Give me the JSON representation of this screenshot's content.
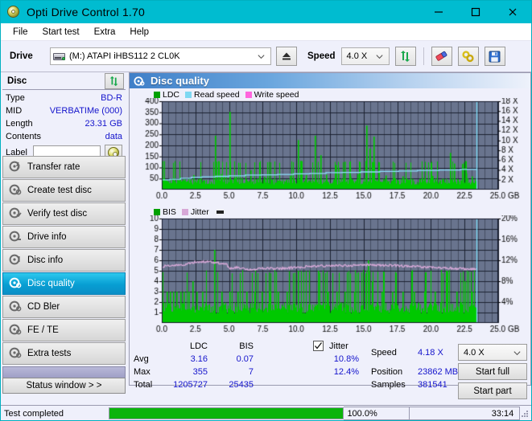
{
  "window": {
    "title": "Opti Drive Control 1.70",
    "icon": "disc-icon",
    "minimize": "—",
    "maximize": "□",
    "close": "✕"
  },
  "menu": {
    "items": [
      "File",
      "Start test",
      "Extra",
      "Help"
    ]
  },
  "toolbar": {
    "drive_label": "Drive",
    "drive_value": "(M:)  ATAPI iHBS112  2 CL0K",
    "eject_icon": "eject-icon",
    "speed_label": "Speed",
    "speed_value": "4.0 X",
    "refresh_icon": "refresh-icon",
    "eraser_icon": "eraser-icon",
    "link_icon": "link-icon",
    "save_icon": "save-icon"
  },
  "disc_panel": {
    "title": "Disc",
    "refresh_icon": "refresh-icon",
    "rows": [
      {
        "key": "Type",
        "value": "BD-R"
      },
      {
        "key": "MID",
        "value": "VERBATIMe (000)"
      },
      {
        "key": "Length",
        "value": "23.31 GB"
      },
      {
        "key": "Contents",
        "value": "data"
      }
    ],
    "label_key": "Label",
    "label_value": "",
    "label_placeholder": "",
    "label_button_icon": "disc-icon"
  },
  "sidebar": {
    "items": [
      {
        "label": "Transfer rate",
        "icon": "disc-bolt-icon",
        "selected": false
      },
      {
        "label": "Create test disc",
        "icon": "disc-create-icon",
        "selected": false
      },
      {
        "label": "Verify test disc",
        "icon": "disc-verify-icon",
        "selected": false
      },
      {
        "label": "Drive info",
        "icon": "drive-info-icon",
        "selected": false
      },
      {
        "label": "Disc info",
        "icon": "disc-info-icon",
        "selected": false
      },
      {
        "label": "Disc quality",
        "icon": "disc-quality-icon",
        "selected": true
      },
      {
        "label": "CD Bler",
        "icon": "disc-bler-icon",
        "selected": false
      },
      {
        "label": "FE / TE",
        "icon": "disc-fete-icon",
        "selected": false
      },
      {
        "label": "Extra tests",
        "icon": "disc-extra-icon",
        "selected": false
      }
    ],
    "status_button": "Status window > >"
  },
  "panel": {
    "title": "Disc quality",
    "icon": "disc-quality-icon"
  },
  "chart_data": [
    {
      "type": "line",
      "name": "ldc-chart",
      "title": "",
      "legend": [
        {
          "label": "LDC",
          "color": "#00a000"
        },
        {
          "label": "Read speed",
          "color": "#7fd8f2"
        },
        {
          "label": "Write speed",
          "color": "#ff66dd"
        }
      ],
      "legend_position": "top-left",
      "xlabel": "GB",
      "x_unit": "GB",
      "xlim": [
        0,
        25
      ],
      "xticks": [
        "0.0",
        "2.5",
        "5.0",
        "7.5",
        "10.0",
        "12.5",
        "15.0",
        "17.5",
        "20.0",
        "22.5",
        "25.0"
      ],
      "ylabel": "",
      "ylim": [
        0,
        400
      ],
      "yticks": [
        "50",
        "100",
        "150",
        "200",
        "250",
        "300",
        "350",
        "400"
      ],
      "y2label": "X",
      "y2lim": [
        0,
        18
      ],
      "y2ticks": [
        "2 X",
        "4 X",
        "6 X",
        "8 X",
        "10 X",
        "12 X",
        "14 X",
        "16 X",
        "18 X"
      ],
      "grid": true,
      "data_end_gb": 23.4,
      "cursor_line_gb": 23.4,
      "series": [
        {
          "name": "LDC",
          "color": "#00c800",
          "kind": "bars",
          "baseline_avg": 3.16,
          "peaks": [
            {
              "x": 1.3,
              "y": 58
            },
            {
              "x": 1.55,
              "y": 42
            },
            {
              "x": 1.8,
              "y": 35
            },
            {
              "x": 2.35,
              "y": 66
            },
            {
              "x": 2.7,
              "y": 48
            },
            {
              "x": 3.05,
              "y": 40
            },
            {
              "x": 3.95,
              "y": 244
            },
            {
              "x": 4.35,
              "y": 70
            },
            {
              "x": 4.6,
              "y": 58
            },
            {
              "x": 5.05,
              "y": 352
            },
            {
              "x": 5.5,
              "y": 60
            },
            {
              "x": 5.9,
              "y": 52
            },
            {
              "x": 6.6,
              "y": 88
            },
            {
              "x": 7.0,
              "y": 46
            },
            {
              "x": 7.6,
              "y": 58
            },
            {
              "x": 8.2,
              "y": 44
            },
            {
              "x": 8.8,
              "y": 40
            },
            {
              "x": 9.5,
              "y": 62
            },
            {
              "x": 10.1,
              "y": 224
            },
            {
              "x": 10.3,
              "y": 130
            },
            {
              "x": 10.7,
              "y": 66
            },
            {
              "x": 11.35,
              "y": 244
            },
            {
              "x": 11.8,
              "y": 156
            },
            {
              "x": 12.2,
              "y": 68
            },
            {
              "x": 12.9,
              "y": 112
            },
            {
              "x": 13.1,
              "y": 98
            },
            {
              "x": 13.55,
              "y": 126
            },
            {
              "x": 14.0,
              "y": 60
            },
            {
              "x": 14.55,
              "y": 70
            },
            {
              "x": 15.2,
              "y": 290
            },
            {
              "x": 15.45,
              "y": 186
            },
            {
              "x": 15.75,
              "y": 240
            },
            {
              "x": 16.1,
              "y": 86
            },
            {
              "x": 16.6,
              "y": 64
            },
            {
              "x": 17.2,
              "y": 52
            },
            {
              "x": 17.9,
              "y": 60
            },
            {
              "x": 18.6,
              "y": 48
            },
            {
              "x": 19.3,
              "y": 56
            },
            {
              "x": 20.1,
              "y": 62
            },
            {
              "x": 20.8,
              "y": 44
            },
            {
              "x": 21.4,
              "y": 166
            },
            {
              "x": 21.7,
              "y": 118
            },
            {
              "x": 22.3,
              "y": 116
            },
            {
              "x": 22.6,
              "y": 74
            },
            {
              "x": 23.0,
              "y": 60
            }
          ]
        },
        {
          "name": "Read speed",
          "color": "#8fe0ff",
          "kind": "step",
          "points": [
            {
              "x": 0.0,
              "y": 2.0
            },
            {
              "x": 0.6,
              "y": 2.1
            },
            {
              "x": 1.4,
              "y": 2.3
            },
            {
              "x": 2.2,
              "y": 2.5
            },
            {
              "x": 3.0,
              "y": 2.6
            },
            {
              "x": 4.0,
              "y": 2.7
            },
            {
              "x": 5.0,
              "y": 2.8
            },
            {
              "x": 6.2,
              "y": 2.95
            },
            {
              "x": 7.4,
              "y": 3.0
            },
            {
              "x": 8.6,
              "y": 3.1
            },
            {
              "x": 9.8,
              "y": 3.2
            },
            {
              "x": 11.0,
              "y": 3.3
            },
            {
              "x": 12.2,
              "y": 3.45
            },
            {
              "x": 13.4,
              "y": 3.5
            },
            {
              "x": 14.8,
              "y": 3.6
            },
            {
              "x": 16.2,
              "y": 3.7
            },
            {
              "x": 17.6,
              "y": 3.8
            },
            {
              "x": 19.0,
              "y": 3.9
            },
            {
              "x": 20.6,
              "y": 4.0
            },
            {
              "x": 22.2,
              "y": 4.1
            },
            {
              "x": 23.4,
              "y": 4.18
            }
          ]
        }
      ]
    },
    {
      "type": "line",
      "name": "bis-jitter-chart",
      "title": "",
      "legend": [
        {
          "label": "BIS",
          "color": "#00a000"
        },
        {
          "label": "Jitter",
          "color": "#d7a8d7"
        }
      ],
      "legend_position": "top-left",
      "xlabel": "GB",
      "x_unit": "GB",
      "xlim": [
        0,
        25
      ],
      "xticks": [
        "0.0",
        "2.5",
        "5.0",
        "7.5",
        "10.0",
        "12.5",
        "15.0",
        "17.5",
        "20.0",
        "22.5",
        "25.0"
      ],
      "ylim": [
        0,
        10
      ],
      "yticks": [
        "1",
        "2",
        "3",
        "4",
        "5",
        "6",
        "7",
        "8",
        "9",
        "10"
      ],
      "y2lim": [
        0,
        20
      ],
      "y2ticks": [
        "4%",
        "8%",
        "12%",
        "16%",
        "20%"
      ],
      "grid": true,
      "data_end_gb": 23.4,
      "cursor_line_gb": 23.4,
      "series": [
        {
          "name": "BIS",
          "color": "#00c800",
          "kind": "bars",
          "baseline_avg": 0.07,
          "peaks": [
            {
              "x": 0.35,
              "y": 3
            },
            {
              "x": 0.6,
              "y": 3
            },
            {
              "x": 0.85,
              "y": 3
            },
            {
              "x": 1.1,
              "y": 3
            },
            {
              "x": 1.35,
              "y": 3
            },
            {
              "x": 1.6,
              "y": 3
            },
            {
              "x": 1.95,
              "y": 3
            },
            {
              "x": 2.3,
              "y": 4
            },
            {
              "x": 2.6,
              "y": 3
            },
            {
              "x": 3.0,
              "y": 3
            },
            {
              "x": 3.9,
              "y": 7
            },
            {
              "x": 4.4,
              "y": 3
            },
            {
              "x": 5.0,
              "y": 3
            },
            {
              "x": 5.6,
              "y": 3
            },
            {
              "x": 6.3,
              "y": 3
            },
            {
              "x": 6.9,
              "y": 3
            },
            {
              "x": 7.4,
              "y": 3
            },
            {
              "x": 8.0,
              "y": 3
            },
            {
              "x": 8.6,
              "y": 3
            },
            {
              "x": 9.3,
              "y": 3
            },
            {
              "x": 10.1,
              "y": 5
            },
            {
              "x": 11.6,
              "y": 5
            },
            {
              "x": 12.3,
              "y": 3
            },
            {
              "x": 13.0,
              "y": 3
            },
            {
              "x": 13.6,
              "y": 3
            },
            {
              "x": 14.3,
              "y": 3
            },
            {
              "x": 15.3,
              "y": 6
            },
            {
              "x": 15.6,
              "y": 4
            },
            {
              "x": 16.3,
              "y": 3
            },
            {
              "x": 17.1,
              "y": 3
            },
            {
              "x": 17.9,
              "y": 3
            },
            {
              "x": 18.7,
              "y": 3
            },
            {
              "x": 19.5,
              "y": 3
            },
            {
              "x": 20.3,
              "y": 3
            },
            {
              "x": 21.2,
              "y": 5
            },
            {
              "x": 21.9,
              "y": 3
            },
            {
              "x": 22.5,
              "y": 4
            },
            {
              "x": 23.0,
              "y": 3
            }
          ]
        },
        {
          "name": "Jitter",
          "color": "#d9aad9",
          "kind": "line",
          "points": [
            {
              "x": 0.0,
              "y": 10.8
            },
            {
              "x": 0.6,
              "y": 11.0
            },
            {
              "x": 1.2,
              "y": 11.1
            },
            {
              "x": 1.8,
              "y": 11.2
            },
            {
              "x": 2.4,
              "y": 11.6
            },
            {
              "x": 3.0,
              "y": 11.8
            },
            {
              "x": 3.6,
              "y": 11.7
            },
            {
              "x": 4.2,
              "y": 11.5
            },
            {
              "x": 4.8,
              "y": 11.4
            },
            {
              "x": 5.0,
              "y": 10.5
            },
            {
              "x": 5.6,
              "y": 10.6
            },
            {
              "x": 6.2,
              "y": 10.4
            },
            {
              "x": 6.6,
              "y": 10.2
            },
            {
              "x": 7.2,
              "y": 10.4
            },
            {
              "x": 7.8,
              "y": 10.5
            },
            {
              "x": 8.6,
              "y": 10.4
            },
            {
              "x": 9.4,
              "y": 10.5
            },
            {
              "x": 10.2,
              "y": 10.7
            },
            {
              "x": 11.0,
              "y": 10.8
            },
            {
              "x": 11.8,
              "y": 10.9
            },
            {
              "x": 12.6,
              "y": 10.9
            },
            {
              "x": 13.4,
              "y": 11.0
            },
            {
              "x": 14.2,
              "y": 11.0
            },
            {
              "x": 15.0,
              "y": 11.1
            },
            {
              "x": 15.8,
              "y": 11.1
            },
            {
              "x": 16.6,
              "y": 11.0
            },
            {
              "x": 17.4,
              "y": 11.0
            },
            {
              "x": 18.2,
              "y": 10.9
            },
            {
              "x": 19.0,
              "y": 10.8
            },
            {
              "x": 19.8,
              "y": 10.7
            },
            {
              "x": 20.6,
              "y": 10.6
            },
            {
              "x": 21.4,
              "y": 10.5
            },
            {
              "x": 22.2,
              "y": 10.4
            },
            {
              "x": 23.0,
              "y": 10.3
            },
            {
              "x": 23.4,
              "y": 10.2
            }
          ]
        }
      ]
    }
  ],
  "stats": {
    "col_ldc": "LDC",
    "col_bis": "BIS",
    "jitter_label": "Jitter",
    "jitter_checked": true,
    "rows": [
      {
        "label": "Avg",
        "ldc": "3.16",
        "bis": "0.07",
        "jitter": "10.8%"
      },
      {
        "label": "Max",
        "ldc": "355",
        "bis": "7",
        "jitter": "12.4%"
      },
      {
        "label": "Total",
        "ldc": "1205727",
        "bis": "25435",
        "jitter": ""
      }
    ],
    "speed_label": "Speed",
    "speed_value": "4.18 X",
    "position_label": "Position",
    "position_value": "23862 MB",
    "samples_label": "Samples",
    "samples_value": "381541",
    "speed_select": "4.0 X",
    "start_full": "Start full",
    "start_part": "Start part"
  },
  "statusbar": {
    "message": "Test completed",
    "progress_percent": 100.0,
    "progress_text": "100.0%",
    "elapsed": "33:14"
  },
  "colors": {
    "accent": "#00bcd0",
    "panel_bg": "#eff0fb",
    "plot_bg": "#69748e",
    "ldc_green": "#00c800",
    "read_speed": "#8fe0ff",
    "write_speed": "#ff66dd",
    "jitter_pink": "#d9aad9",
    "value_blue": "#1414cc",
    "progress_green": "#0cb40c"
  }
}
